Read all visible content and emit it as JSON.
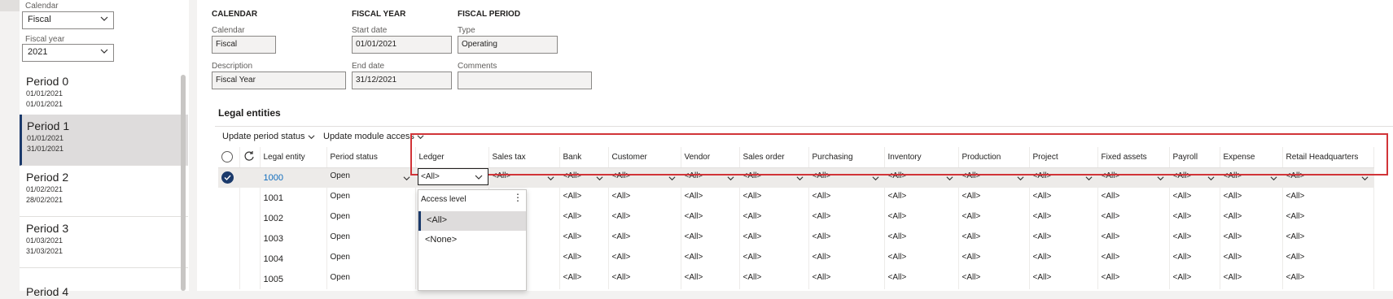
{
  "sidebar": {
    "calendar_label": "Calendar",
    "calendar_value": "Fiscal",
    "fiscal_year_label": "Fiscal year",
    "fiscal_year_value": "2021",
    "periods": [
      {
        "name": "Period 0",
        "start": "01/01/2021",
        "end": "01/01/2021"
      },
      {
        "name": "Period 1",
        "start": "01/01/2021",
        "end": "31/01/2021"
      },
      {
        "name": "Period 2",
        "start": "01/02/2021",
        "end": "28/02/2021"
      },
      {
        "name": "Period 3",
        "start": "01/03/2021",
        "end": "31/03/2021"
      },
      {
        "name": "Period 4",
        "start": "",
        "end": ""
      }
    ]
  },
  "header": {
    "calendar_heading": "CALENDAR",
    "fiscal_year_heading": "FISCAL YEAR",
    "fiscal_period_heading": "FISCAL PERIOD",
    "calendar_label": "Calendar",
    "calendar_value": "Fiscal",
    "description_label": "Description",
    "description_value": "Fiscal Year",
    "start_date_label": "Start date",
    "start_date_value": "01/01/2021",
    "end_date_label": "End date",
    "end_date_value": "31/12/2021",
    "type_label": "Type",
    "type_value": "Operating",
    "comments_label": "Comments",
    "comments_value": ""
  },
  "legal_entities": {
    "title": "Legal entities",
    "toolbar": {
      "update_period_status": "Update period status",
      "update_module_access": "Update module access"
    },
    "columns": [
      "Legal entity",
      "Period status",
      "Ledger",
      "Sales tax",
      "Bank",
      "Customer",
      "Vendor",
      "Sales order",
      "Purchasing",
      "Inventory",
      "Production",
      "Project",
      "Fixed assets",
      "Payroll",
      "Expense",
      "Retail Headquarters"
    ],
    "rows": [
      {
        "entity": "1000",
        "status": "Open",
        "ledger": "<All>",
        "sales_tax": "<All>",
        "bank": "<All>",
        "customer": "<All>",
        "vendor": "<All>",
        "sales_order": "<All>",
        "purchasing": "<All>",
        "inventory": "<All>",
        "production": "<All>",
        "project": "<All>",
        "fixed_assets": "<All>",
        "payroll": "<All>",
        "expense": "<All>",
        "retail": "<All>"
      },
      {
        "entity": "1001",
        "status": "Open",
        "ledger": "",
        "sales_tax": "",
        "bank": "<All>",
        "customer": "<All>",
        "vendor": "<All>",
        "sales_order": "<All>",
        "purchasing": "<All>",
        "inventory": "<All>",
        "production": "<All>",
        "project": "<All>",
        "fixed_assets": "<All>",
        "payroll": "<All>",
        "expense": "<All>",
        "retail": "<All>"
      },
      {
        "entity": "1002",
        "status": "Open",
        "ledger": "",
        "sales_tax": "",
        "bank": "<All>",
        "customer": "<All>",
        "vendor": "<All>",
        "sales_order": "<All>",
        "purchasing": "<All>",
        "inventory": "<All>",
        "production": "<All>",
        "project": "<All>",
        "fixed_assets": "<All>",
        "payroll": "<All>",
        "expense": "<All>",
        "retail": "<All>"
      },
      {
        "entity": "1003",
        "status": "Open",
        "ledger": "",
        "sales_tax": "",
        "bank": "<All>",
        "customer": "<All>",
        "vendor": "<All>",
        "sales_order": "<All>",
        "purchasing": "<All>",
        "inventory": "<All>",
        "production": "<All>",
        "project": "<All>",
        "fixed_assets": "<All>",
        "payroll": "<All>",
        "expense": "<All>",
        "retail": "<All>"
      },
      {
        "entity": "1004",
        "status": "Open",
        "ledger": "",
        "sales_tax": "",
        "bank": "<All>",
        "customer": "<All>",
        "vendor": "<All>",
        "sales_order": "<All>",
        "purchasing": "<All>",
        "inventory": "<All>",
        "production": "<All>",
        "project": "<All>",
        "fixed_assets": "<All>",
        "payroll": "<All>",
        "expense": "<All>",
        "retail": "<All>"
      },
      {
        "entity": "1005",
        "status": "Open",
        "ledger": "",
        "sales_tax": "",
        "bank": "<All>",
        "customer": "<All>",
        "vendor": "<All>",
        "sales_order": "<All>",
        "purchasing": "<All>",
        "inventory": "<All>",
        "production": "<All>",
        "project": "<All>",
        "fixed_assets": "<All>",
        "payroll": "<All>",
        "expense": "<All>",
        "retail": "<All>"
      }
    ]
  },
  "ledger_dropdown": {
    "header": "Access level",
    "more": "⋮",
    "options": [
      "<All>",
      "<None>"
    ],
    "selected_value": "<All>"
  },
  "colors": {
    "accent": "#1b3a6b",
    "highlight": "#d13438",
    "link": "#0f6cbd"
  }
}
